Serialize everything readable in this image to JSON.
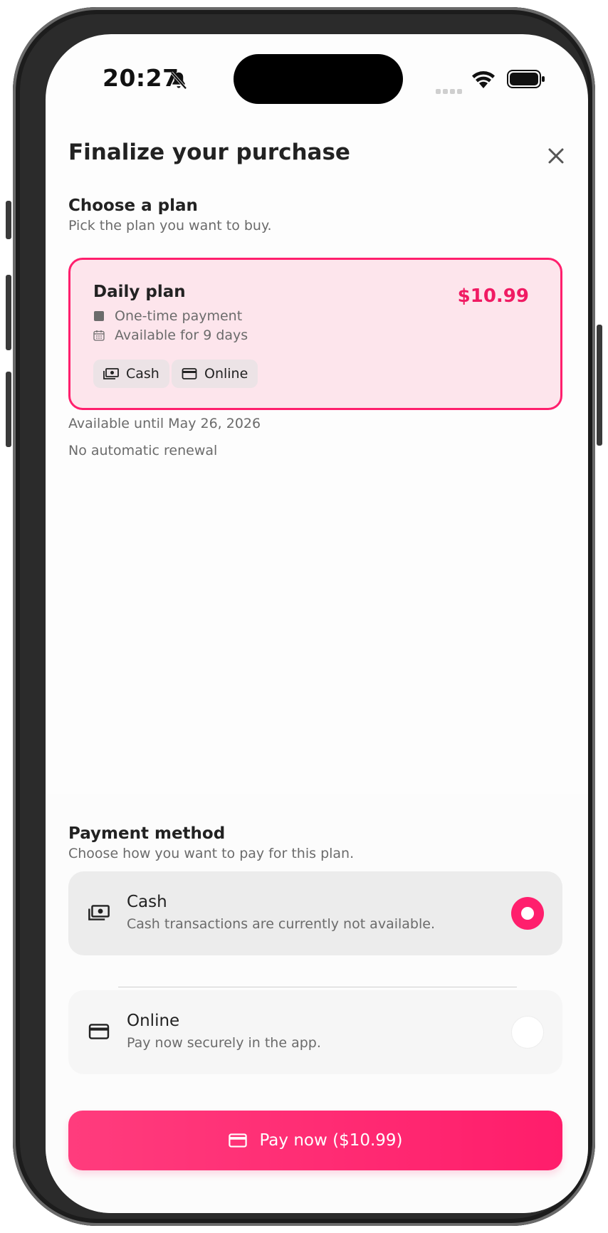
{
  "status_bar": {
    "time": "20:27"
  },
  "header": {
    "title": "Finalize your purchase"
  },
  "plan_section": {
    "heading": "Choose a plan",
    "subheading": "Pick the plan you want to buy.",
    "plan": {
      "name": "Daily plan",
      "price": "$10.99",
      "payment_type": "One-time payment",
      "availability": "Available for 9 days",
      "chips": [
        "Cash",
        "Online"
      ]
    },
    "available_until": "Available until May 26, 2026",
    "renewal": "No automatic renewal"
  },
  "payment_section": {
    "heading": "Payment method",
    "subheading": "Choose how you want to pay for this plan.",
    "options": [
      {
        "title": "Cash",
        "subtitle": "Cash transactions are currently not available.",
        "selected": true,
        "icon": "cash-icon"
      },
      {
        "title": "Online",
        "subtitle": "Pay now securely in the app.",
        "selected": false,
        "icon": "credit-card-icon"
      }
    ]
  },
  "pay_button": {
    "label": "Pay now ($10.99)"
  },
  "colors": {
    "accent": "#ff1f6d",
    "selected_card_bg": "#fde5ec"
  }
}
